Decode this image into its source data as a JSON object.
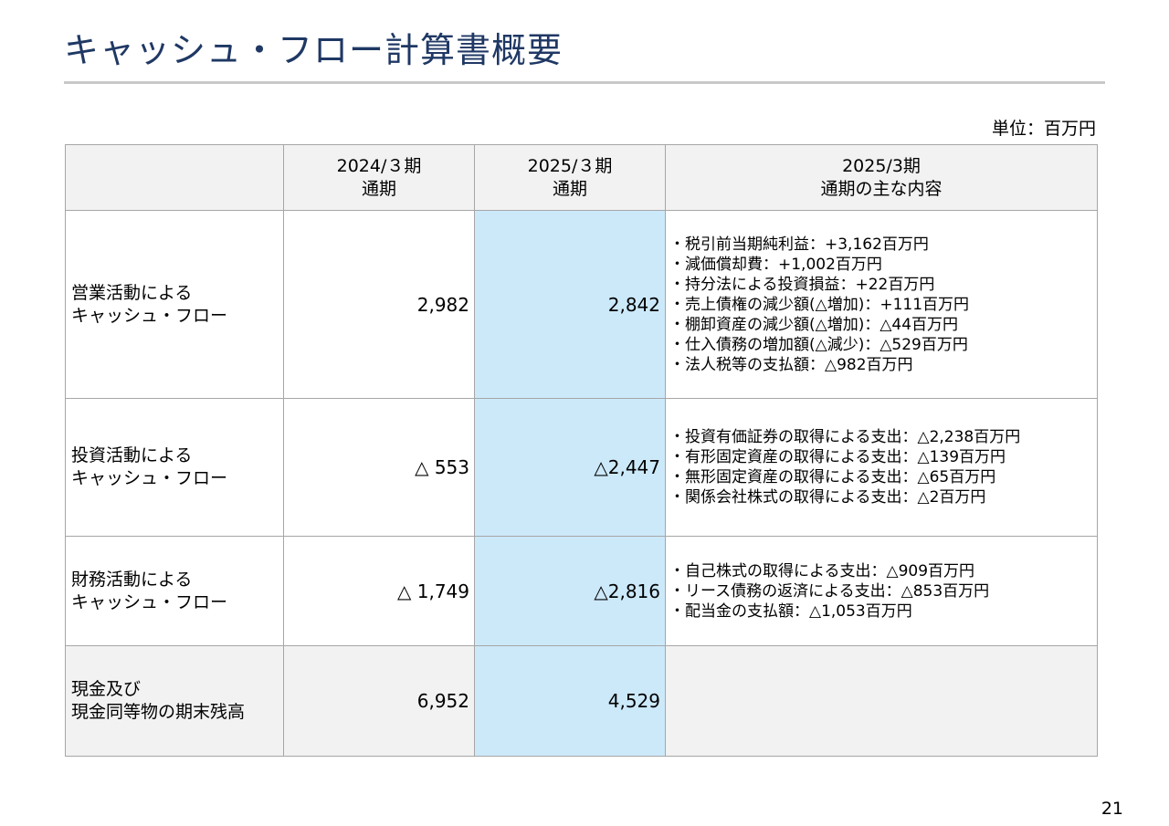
{
  "page": {
    "title": "キャッシュ・フロー計算書概要",
    "unit": "単位：百万円",
    "page_number": "21"
  },
  "table": {
    "header": {
      "col1": {
        "line1": "2024/３期",
        "line2": "通期"
      },
      "col2": {
        "line1": "2025/３期",
        "line2": "通期"
      },
      "col3": {
        "line1": "2025/3期",
        "line2": "通期の主な内容"
      }
    },
    "rows": [
      {
        "label1": "営業活動による",
        "label2": "キャッシュ・フロー",
        "prev": "2,982",
        "curr": "2,842",
        "notes": [
          "・税引前当期純利益：+3,162百万円",
          "・減価償却費：+1,002百万円",
          "・持分法による投資損益：+22百万円",
          "・売上債権の減少額(△増加)：+111百万円",
          "・棚卸資産の減少額(△増加)：△44百万円",
          "・仕入債務の増加額(△減少)：△529百万円",
          "・法人税等の支払額：△982百万円"
        ]
      },
      {
        "label1": "投資活動による",
        "label2": "キャッシュ・フロー",
        "prev": "△ 553",
        "curr": "△2,447",
        "notes": [
          "・投資有価証券の取得による支出：△2,238百万円",
          "・有形固定資産の取得による支出：△139百万円",
          "・無形固定資産の取得による支出：△65百万円",
          "・関係会社株式の取得による支出：△2百万円"
        ]
      },
      {
        "label1": "財務活動による",
        "label2": "キャッシュ・フロー",
        "prev": "△ 1,749",
        "curr": "△2,816",
        "notes": [
          "・自己株式の取得による支出：△909百万円",
          "・リース債務の返済による支出：△853百万円",
          "・配当金の支払額：△1,053百万円"
        ]
      },
      {
        "label1": "現金及び",
        "label2": "現金同等物の期末残高",
        "prev": "6,952",
        "curr": "4,529",
        "notes": []
      }
    ]
  },
  "colors": {
    "title": "#1f3864",
    "highlight": "#cce9fa",
    "header_bg": "#f2f2f2",
    "border": "#a6a6a6"
  }
}
